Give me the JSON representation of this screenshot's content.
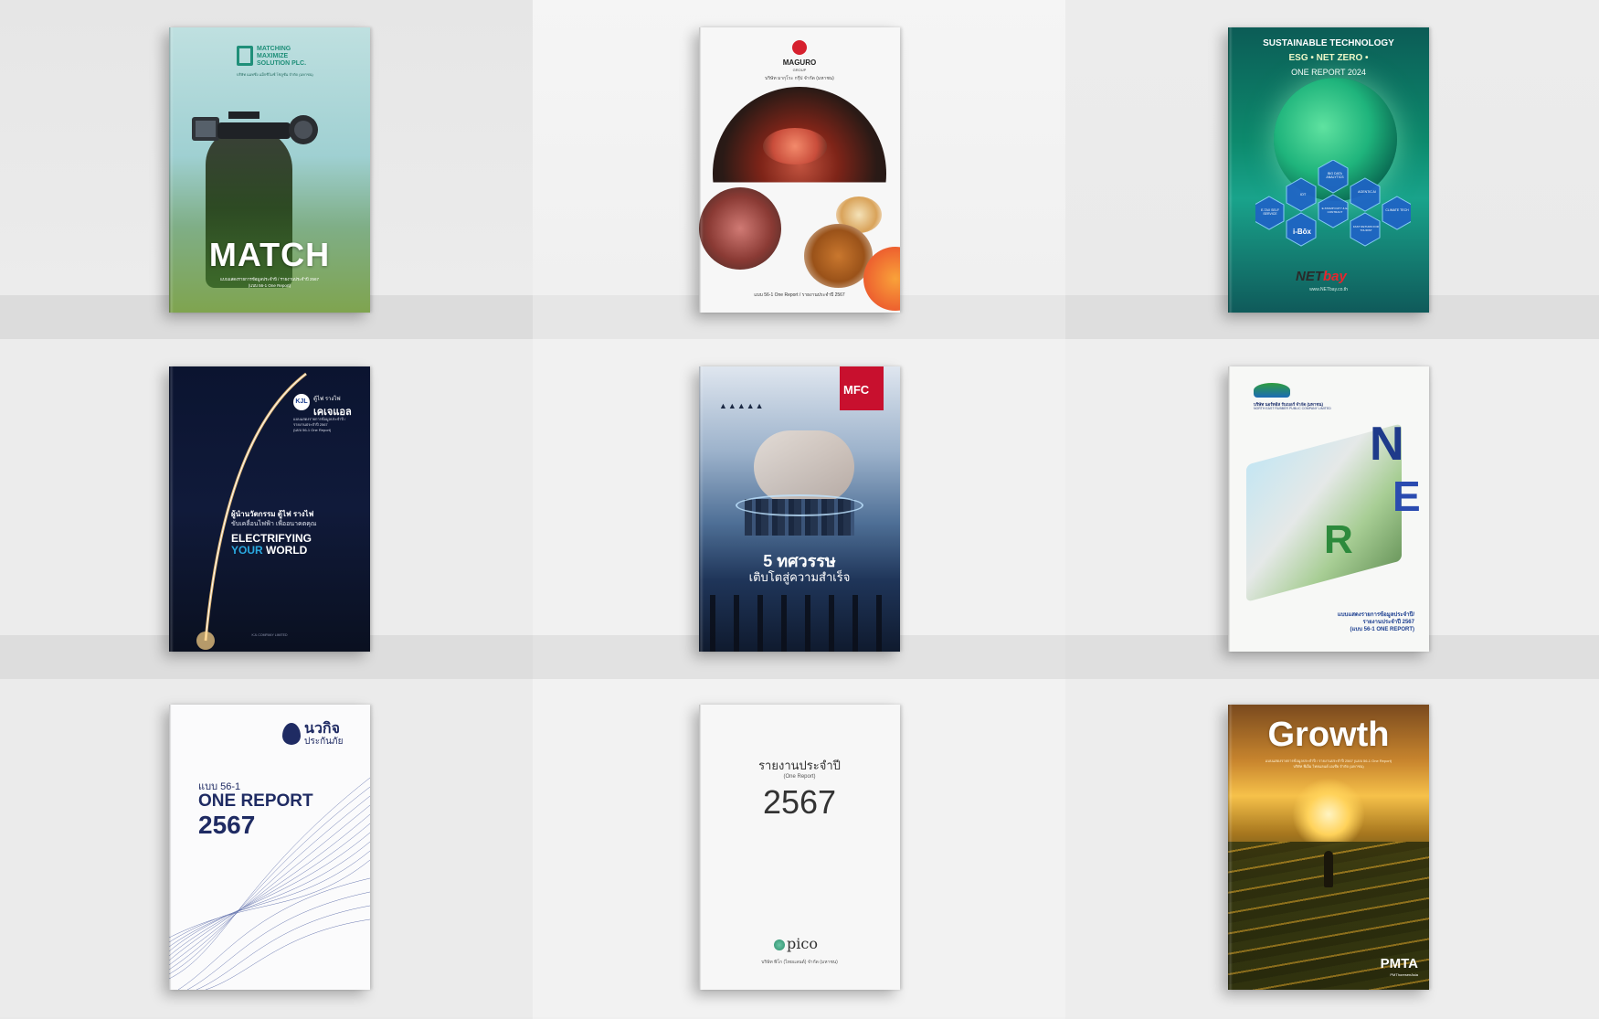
{
  "books": [
    {
      "id": "match",
      "logo_lines": [
        "MATCHING",
        "MAXIMIZE",
        "SOLUTION PLC."
      ],
      "logo_subtitle": "บริษัท แมทชิ่ง แม็กซิไมซ์ โซลูชั่น จำกัด (มหาชน)",
      "title": "MATCH",
      "report_line": "แบบแสดงรายการข้อมูลประจำปี / รายงานประจำปี 2567",
      "report_sub": "(แบบ 56-1 One Report)"
    },
    {
      "id": "maguro",
      "brand": "MAGURO",
      "brand_sub": "GROUP",
      "company": "บริษัท มากุโระ กรุ๊ป จำกัด (มหาชน)",
      "footer": "แบบ 56-1 One Report / รายงานประจำปี 2567"
    },
    {
      "id": "netbay",
      "headline": "SUSTAINABLE TECHNOLOGY",
      "subline": "ESG • NET ZERO •",
      "year_line": "ONE REPORT 2024",
      "hexes": [
        "BIG DATA ANALYTICS",
        "AGENTIC AI",
        "IOT",
        "E-TAX SELF SERVICE",
        "E-STAMP DUTY & E-CONTRACT",
        "CLIMATE TECH",
        "i-Bōx",
        "FAST RETURN FOR TOURIST"
      ],
      "brand_a": "NET",
      "brand_b": "bay",
      "url": "www.NETbay.co.th"
    },
    {
      "id": "kjl",
      "brand_thai_1": "ตู้ไฟ รางไฟ",
      "brand_thai_2": "เคเจแอล",
      "report_lines": [
        "แบบแสดงรายการข้อมูลประจำปี /",
        "รายงานประจำปี 2567",
        "(แบบ 56-1 One Report)"
      ],
      "tagline_1": "ผู้นำนวัตกรรม ตู้ไฟ รางไฟ",
      "tagline_2": "ขับเคลื่อนไฟฟ้า เพื่ออนาคตคุณ",
      "headline_1": "ELECTRIFYING",
      "headline_2a": "YOUR",
      "headline_2b": "WORLD",
      "footer": "KJL COMPANY LIMITED"
    },
    {
      "id": "mfc",
      "brand": "MFC",
      "rating": "▲▲▲▲▲",
      "title": "5 ทศวรรษ",
      "subtitle": "เติบโตสู่ความสำเร็จ"
    },
    {
      "id": "ner",
      "company": "บริษัท นอร์ทอีส รับเบอร์ จำกัด (มหาชน)",
      "company_en": "NORTH EAST RUBBER PUBLIC COMPANY LIMITED",
      "letters": [
        "N",
        "E",
        "R"
      ],
      "report_lines": [
        "แบบแสดงรายการข้อมูลประจำปี/",
        "รายงานประจำปี 2567",
        "(แบบ 56-1 ONE REPORT)"
      ]
    },
    {
      "id": "navakij",
      "brand_1": "นวกิจ",
      "brand_2": "ประกันภัย",
      "form": "แบบ 56-1",
      "line": "ONE REPORT",
      "year": "2567"
    },
    {
      "id": "pico",
      "title": "รายงานประจำปี",
      "subtitle": "(One Report)",
      "year": "2567",
      "brand": "pico",
      "company": "บริษัท พิโก (ไทยแลนด์) จำกัด (มหาชน)"
    },
    {
      "id": "pmta",
      "title": "Growth",
      "sub_1": "แบบแสดงรายการข้อมูลประจำปี / รายงานประจำปี 2567 (แบบ 56-1 One Report)",
      "sub_2": "บริษัท พีเอ็ม ไทยแลนด์ เอเชีย จำกัด (มหาชน)",
      "brand": "PMTA",
      "brand_sub": "PMThoresenAsia"
    }
  ]
}
